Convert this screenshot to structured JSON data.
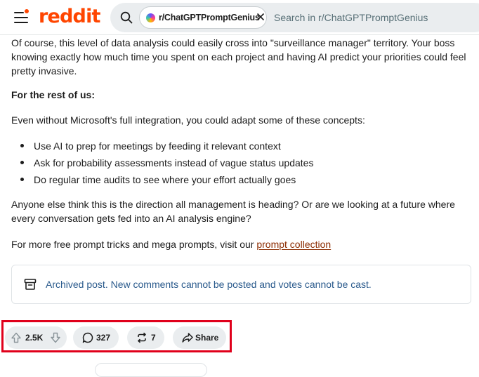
{
  "header": {
    "logo": "reddit",
    "search_chip": "r/ChatGPTPromptGenius",
    "search_placeholder": "Search in r/ChatGPTPromptGenius"
  },
  "post": {
    "para1": "Of course, this level of data analysis could easily cross into \"surveillance manager\" territory. Your boss knowing exactly how much time you spent on each project and having AI predict your priorities could feel pretty invasive.",
    "heading": "For the rest of us:",
    "para2": "Even without Microsoft's full integration, you could adapt some of these concepts:",
    "bullets": [
      "Use AI to prep for meetings by feeding it relevant context",
      "Ask for probability assessments instead of vague status updates",
      "Do regular time audits to see where your effort actually goes"
    ],
    "para3": "Anyone else think this is the direction all management is heading? Or are we looking at a future where every conversation gets fed into an AI analysis engine?",
    "para4_prefix": "For more free prompt tricks and mega prompts, visit our ",
    "para4_link": "prompt collection"
  },
  "archived_notice": "Archived post. New comments cannot be posted and votes cannot be cast.",
  "actions": {
    "votes": "2.5K",
    "comments": "327",
    "crossposts": "7",
    "share": "Share"
  },
  "colors": {
    "brand": "#ff4500",
    "highlight": "#e0001b",
    "link": "#8b2b00",
    "notice_text": "#2a5a8c"
  }
}
